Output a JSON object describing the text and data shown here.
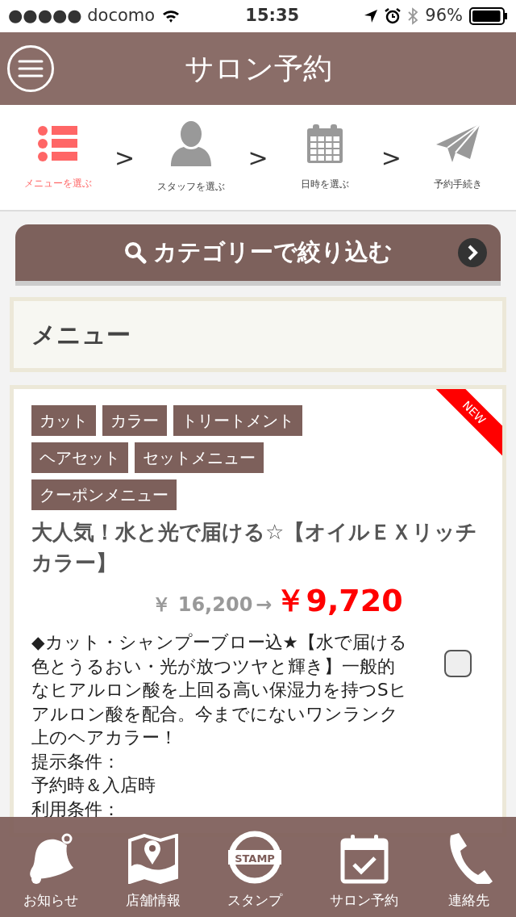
{
  "status_bar": {
    "carrier": "●●●●● docomo",
    "time": "15:35",
    "battery": "96%"
  },
  "header": {
    "title": "サロン予約"
  },
  "steps": [
    {
      "kind": "list",
      "label": "メニューを選ぶ",
      "selected": true
    },
    {
      "kind": "person",
      "label": "スタッフを選ぶ",
      "selected": false
    },
    {
      "kind": "calendar",
      "label": "日時を選ぶ",
      "selected": false
    },
    {
      "kind": "plane",
      "label": "予約手続き",
      "selected": false
    }
  ],
  "step_separators": [
    ">",
    ">",
    ">"
  ],
  "filter_button": {
    "label": "カテゴリーで絞り込む"
  },
  "section_title": "メニュー",
  "menu_item": {
    "badge": "NEW",
    "tags": [
      "カット",
      "カラー",
      "トリートメント",
      "ヘアセット",
      "セットメニュー",
      "クーポンメニュー"
    ],
    "title": "大人気！水と光で届ける☆【オイルＥＸリッチカラー】",
    "original_price": "￥ 16,200",
    "arrow": "→",
    "sale_price": "￥9,720",
    "description": [
      "◆カット・シャンプーブロー込★【水で届ける色とうるおい・光が放つツヤと輝き】一般的なヒアルロン酸を上回る高い保湿力を持つSヒアルロン酸を配合。今までにないワンランク上のヘアカラー！",
      "提示条件：",
      "予約時＆入店時",
      "利用条件："
    ],
    "checked": false
  },
  "bottom_nav": [
    {
      "kind": "bell",
      "label": "お知らせ"
    },
    {
      "kind": "map",
      "label": "店舗情報"
    },
    {
      "kind": "stamp",
      "label": "スタンプ",
      "icon_text": "STAMP"
    },
    {
      "kind": "calendar",
      "label": "サロン予約"
    },
    {
      "kind": "phone",
      "label": "連絡先"
    }
  ]
}
